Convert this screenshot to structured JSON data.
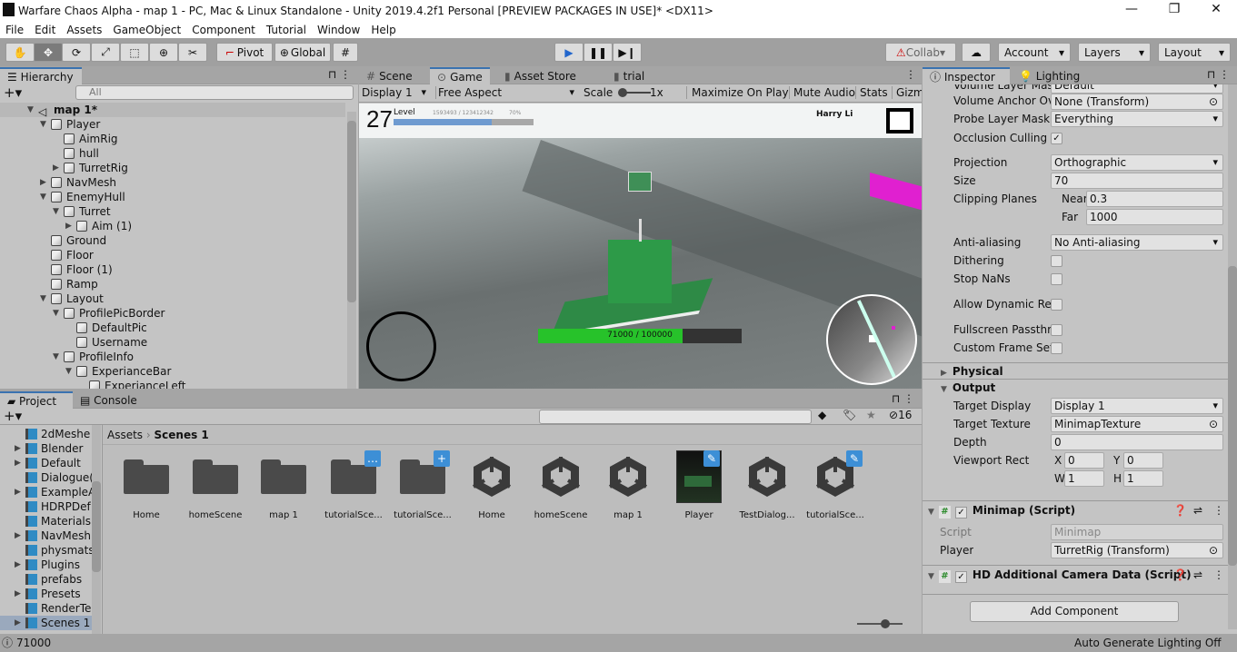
{
  "window": {
    "title": "Warfare Chaos Alpha - map 1 - PC, Mac & Linux Standalone - Unity 2019.4.2f1 Personal [PREVIEW PACKAGES IN USE]* <DX11>",
    "minimize": "—",
    "maximize": "❐",
    "close": "✕"
  },
  "menu": [
    "File",
    "Edit",
    "Assets",
    "GameObject",
    "Component",
    "Tutorial",
    "Window",
    "Help"
  ],
  "toolbar": {
    "pivot": "Pivot",
    "global": "Global",
    "collab": "Collab",
    "account": "Account",
    "layers": "Layers",
    "layout": "Layout",
    "accent": "#3a72b0"
  },
  "hierarchy": {
    "tab": "Hierarchy",
    "search_placeholder": "All",
    "items": [
      {
        "label": "map 1*",
        "depth": 0,
        "arrow": "open",
        "bold": true
      },
      {
        "label": "Player",
        "depth": 1,
        "arrow": "open"
      },
      {
        "label": "AimRig",
        "depth": 2
      },
      {
        "label": "hull",
        "depth": 2
      },
      {
        "label": "TurretRig",
        "depth": 2,
        "arrow": "closed"
      },
      {
        "label": "NavMesh",
        "depth": 1,
        "arrow": "closed"
      },
      {
        "label": "EnemyHull",
        "depth": 1,
        "arrow": "open"
      },
      {
        "label": "Turret",
        "depth": 2,
        "arrow": "open"
      },
      {
        "label": "Aim (1)",
        "depth": 3,
        "arrow": "closed"
      },
      {
        "label": "Ground",
        "depth": 1
      },
      {
        "label": "Floor",
        "depth": 1
      },
      {
        "label": "Floor (1)",
        "depth": 1
      },
      {
        "label": "Ramp",
        "depth": 1
      },
      {
        "label": "Layout",
        "depth": 1,
        "arrow": "open"
      },
      {
        "label": "ProfilePicBorder",
        "depth": 2,
        "arrow": "open"
      },
      {
        "label": "DefaultPic",
        "depth": 3
      },
      {
        "label": "Username",
        "depth": 3
      },
      {
        "label": "ProfileInfo",
        "depth": 2,
        "arrow": "open"
      },
      {
        "label": "ExperianceBar",
        "depth": 3,
        "arrow": "open"
      },
      {
        "label": "ExperianceLeft",
        "depth": 4
      }
    ]
  },
  "center_tabs": [
    "Scene",
    "Game",
    "Asset Store",
    "trial"
  ],
  "game_toolbar": {
    "display": "Display 1",
    "aspect": "Free Aspect",
    "scale_label": "Scale",
    "scale_value": "1x",
    "maximize": "Maximize On Play",
    "mute": "Mute Audio",
    "stats": "Stats",
    "gizmos": "Gizm"
  },
  "game_hud": {
    "level": "27",
    "level_label": "Level",
    "xp_text": "1593493 / 123412342",
    "xp_percent_label": "70%",
    "xp_fill": 0.7,
    "player_name": "Harry Li",
    "health_text": "71000 / 100000",
    "health_fill": 0.71
  },
  "project": {
    "tabs": [
      "Project",
      "Console"
    ],
    "hidden_count": "16",
    "breadcrumb": [
      "Assets",
      "Scenes 1"
    ],
    "tree": [
      {
        "label": "2dMeshe",
        "arrow": false
      },
      {
        "label": "Blender",
        "arrow": true
      },
      {
        "label": "Default",
        "arrow": true
      },
      {
        "label": "Dialogue(",
        "arrow": false
      },
      {
        "label": "ExampleA",
        "arrow": true
      },
      {
        "label": "HDRPDef",
        "arrow": false
      },
      {
        "label": "Materials",
        "arrow": false
      },
      {
        "label": "NavMesh",
        "arrow": true
      },
      {
        "label": "physmats",
        "arrow": false
      },
      {
        "label": "Plugins",
        "arrow": true
      },
      {
        "label": "prefabs",
        "arrow": false
      },
      {
        "label": "Presets",
        "arrow": true
      },
      {
        "label": "RenderTe",
        "arrow": false
      },
      {
        "label": "Scenes 1",
        "arrow": true,
        "selected": true
      }
    ],
    "assets": [
      {
        "name": "Home",
        "kind": "folder"
      },
      {
        "name": "homeScene",
        "kind": "folder"
      },
      {
        "name": "map 1",
        "kind": "folder"
      },
      {
        "name": "tutorialSce...",
        "kind": "folder",
        "badge": "…"
      },
      {
        "name": "tutorialSce...",
        "kind": "folder",
        "badge": "+"
      },
      {
        "name": "Home",
        "kind": "scene"
      },
      {
        "name": "homeScene",
        "kind": "scene"
      },
      {
        "name": "map 1",
        "kind": "scene"
      },
      {
        "name": "Player",
        "kind": "prefab",
        "badge": "✎"
      },
      {
        "name": "TestDialog...",
        "kind": "scene"
      },
      {
        "name": "tutorialSce...",
        "kind": "scene",
        "badge": "✎"
      }
    ]
  },
  "inspector": {
    "tabs": [
      "Inspector",
      "Lighting"
    ],
    "volume_layer_mask": {
      "label": "Volume Layer Mas",
      "value": "Default"
    },
    "volume_anchor": {
      "label": "Volume Anchor Ov",
      "value": "None (Transform)"
    },
    "probe_layer_mask": {
      "label": "Probe Layer Mask",
      "value": "Everything"
    },
    "occlusion_culling": {
      "label": "Occlusion Culling",
      "checked": true
    },
    "projection": {
      "label": "Projection",
      "value": "Orthographic"
    },
    "size": {
      "label": "Size",
      "value": "70"
    },
    "clipping": {
      "label": "Clipping Planes",
      "near_label": "Near",
      "near": "0.3",
      "far_label": "Far",
      "far": "1000"
    },
    "antialiasing": {
      "label": "Anti-aliasing",
      "value": "No Anti-aliasing"
    },
    "dithering": {
      "label": "Dithering",
      "checked": false
    },
    "stop_nans": {
      "label": "Stop NaNs",
      "checked": false
    },
    "allow_dynamic": {
      "label": "Allow Dynamic Re",
      "checked": false
    },
    "fullscreen": {
      "label": "Fullscreen Passthr",
      "checked": false
    },
    "custom_frame": {
      "label": "Custom Frame Set",
      "checked": false
    },
    "physical": "Physical",
    "output": "Output",
    "target_display": {
      "label": "Target Display",
      "value": "Display 1"
    },
    "target_texture": {
      "label": "Target Texture",
      "value": "MinimapTexture"
    },
    "depth": {
      "label": "Depth",
      "value": "0"
    },
    "viewport": {
      "label": "Viewport Rect",
      "x": "0",
      "y": "0",
      "w": "1",
      "h": "1",
      "xl": "X",
      "yl": "Y",
      "wl": "W",
      "hl": "H"
    },
    "minimap": {
      "title": "Minimap (Script)",
      "script_label": "Script",
      "script": "Minimap",
      "player_label": "Player",
      "player": "TurretRig (Transform)"
    },
    "hd_camera": {
      "title": "HD Additional Camera Data (Script)"
    },
    "add_component": "Add Component"
  },
  "status": {
    "message": "71000",
    "lighting": "Auto Generate Lighting Off"
  }
}
